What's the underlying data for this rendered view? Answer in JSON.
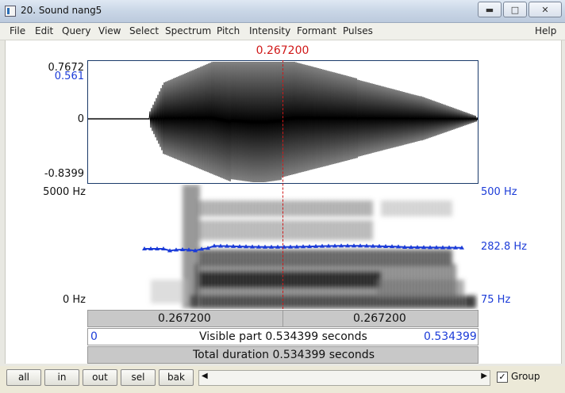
{
  "window": {
    "title": "20. Sound nang5",
    "minimize_icon": "minimize-icon",
    "maximize_icon": "maximize-icon",
    "close_icon": "close-icon"
  },
  "menu": [
    "File",
    "Edit",
    "Query",
    "View",
    "Select",
    "Spectrum",
    "Pitch",
    "Intensity",
    "Formant",
    "Pulses",
    "Help"
  ],
  "cursor": {
    "time": "0.267200",
    "color": "#d01818"
  },
  "waveform": {
    "max": "0.7672",
    "min": "-0.8399",
    "zero": "0",
    "marker": "0.561"
  },
  "spectrogram": {
    "top_freq": "5000 Hz",
    "bottom_freq": "0 Hz",
    "pitch_top": "500 Hz",
    "pitch_mid": "282.8 Hz",
    "pitch_bottom": "75 Hz",
    "pitch_color": "#1c3cd8"
  },
  "time_bars": {
    "left_segment": "0.267200",
    "right_segment": "0.267200",
    "visible_start": "0",
    "visible_label": "Visible part 0.534399 seconds",
    "visible_end": "0.534399",
    "total_label": "Total duration 0.534399 seconds"
  },
  "buttons": {
    "all": "all",
    "in": "in",
    "out": "out",
    "sel": "sel",
    "bak": "bak"
  },
  "group": {
    "label": "Group",
    "checked": true
  }
}
